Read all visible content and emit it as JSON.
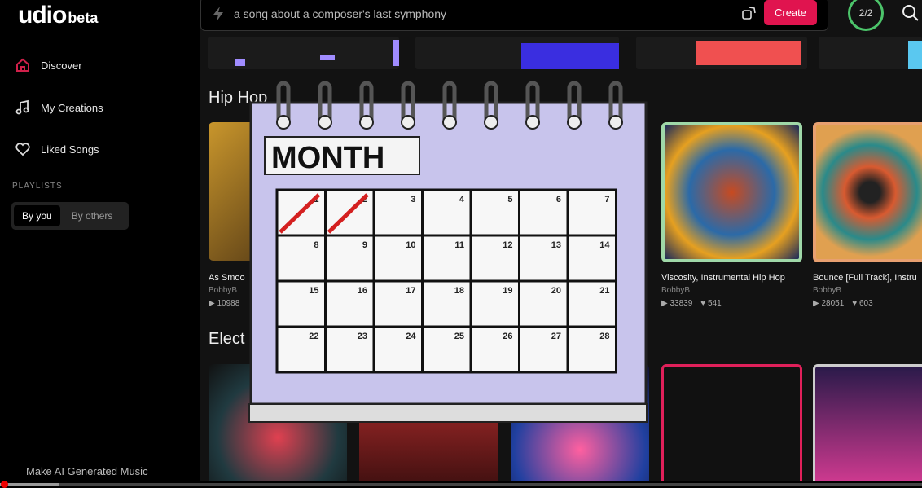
{
  "app": {
    "logo": "udio",
    "logo_suffix": "beta"
  },
  "sidebar": {
    "items": [
      {
        "label": "Discover",
        "icon": "home-icon"
      },
      {
        "label": "My Creations",
        "icon": "music-note-icon"
      },
      {
        "label": "Liked Songs",
        "icon": "heart-icon"
      }
    ],
    "playlists_heading": "PLAYLISTS",
    "playlist_tabs": [
      "By you",
      "By others"
    ],
    "footer": "Make AI Generated Music"
  },
  "header": {
    "search_value": "a song about a composer's last symphony",
    "create_label": "Create",
    "credits": "2/2"
  },
  "sections": [
    {
      "title": "Hip Hop",
      "cards": [
        {
          "title": "As Smoo",
          "artist": "BobbyB",
          "plays": "10988",
          "likes": ""
        },
        {
          "title": "Viscosity, Instrumental Hip Hop",
          "artist": "BobbyB",
          "plays": "33839",
          "likes": "541"
        },
        {
          "title": "Bounce [Full Track], Instru",
          "artist": "BobbyB",
          "plays": "28051",
          "likes": "603"
        }
      ]
    },
    {
      "title": "Elect"
    }
  ],
  "overlay": {
    "calendar_label": "MONTH",
    "days": [
      "1",
      "2",
      "3",
      "4",
      "5",
      "6",
      "7",
      "8",
      "9",
      "10",
      "11",
      "12",
      "13",
      "14",
      "15",
      "16",
      "17",
      "18",
      "19",
      "20",
      "21",
      "22",
      "23",
      "24",
      "25",
      "26",
      "27",
      "28"
    ]
  },
  "colors": {
    "accent": "#e0144f",
    "credits_ring": "#4cc46a",
    "progress": "#ee0000"
  }
}
